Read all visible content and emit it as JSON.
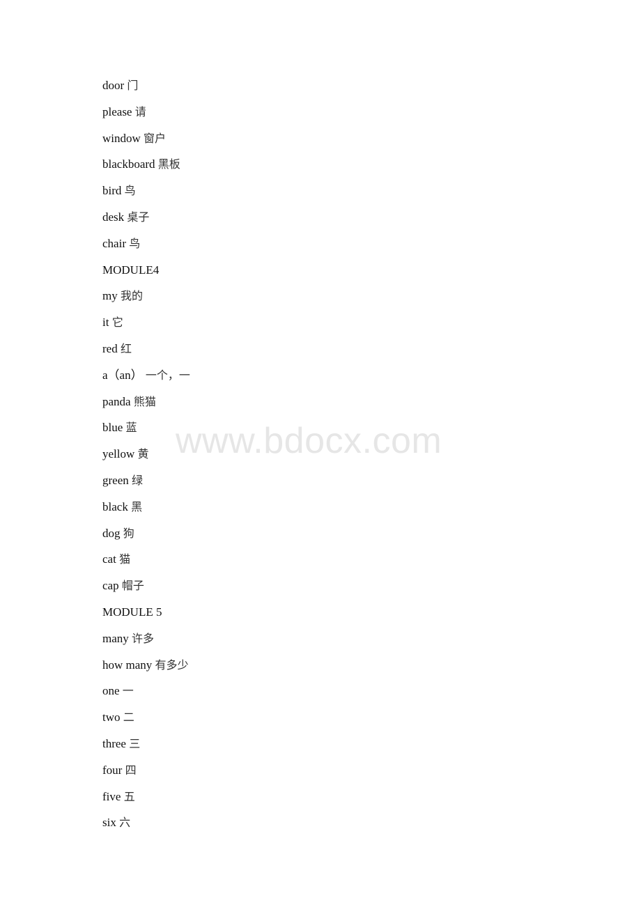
{
  "document": {
    "lines": [
      {
        "en": "door",
        "zh": "门"
      },
      {
        "en": "please",
        "zh": "请"
      },
      {
        "en": "window",
        "zh": "窗户"
      },
      {
        "en": "blackboard",
        "zh": "黑板"
      },
      {
        "en": "bird",
        "zh": "鸟"
      },
      {
        "en": "desk",
        "zh": "桌子"
      },
      {
        "en": "chair",
        "zh": "鸟"
      },
      {
        "en": "MODULE4",
        "zh": ""
      },
      {
        "en": "my",
        "zh": "我的"
      },
      {
        "en": "it",
        "zh": "它"
      },
      {
        "en": "red",
        "zh": "红"
      },
      {
        "en": "a（an）",
        "zh": "一个，一"
      },
      {
        "en": "panda",
        "zh": "熊猫"
      },
      {
        "en": "blue",
        "zh": "蓝"
      },
      {
        "en": "yellow",
        "zh": "黄"
      },
      {
        "en": "green",
        "zh": "绿"
      },
      {
        "en": "black",
        "zh": "黑"
      },
      {
        "en": "dog",
        "zh": "狗"
      },
      {
        "en": "cat",
        "zh": "猫"
      },
      {
        "en": "cap",
        "zh": "帽子"
      },
      {
        "en": "MODULE 5",
        "zh": ""
      },
      {
        "en": "many",
        "zh": "许多"
      },
      {
        "en": "how many",
        "zh": "有多少"
      },
      {
        "en": "one",
        "zh": "一"
      },
      {
        "en": "two",
        "zh": "二"
      },
      {
        "en": "three",
        "zh": "三"
      },
      {
        "en": "four",
        "zh": "四"
      },
      {
        "en": "five",
        "zh": "五"
      },
      {
        "en": "six",
        "zh": "六"
      }
    ]
  },
  "watermark": {
    "text": "www.bdocx.com",
    "color": "#e6e6e6"
  }
}
